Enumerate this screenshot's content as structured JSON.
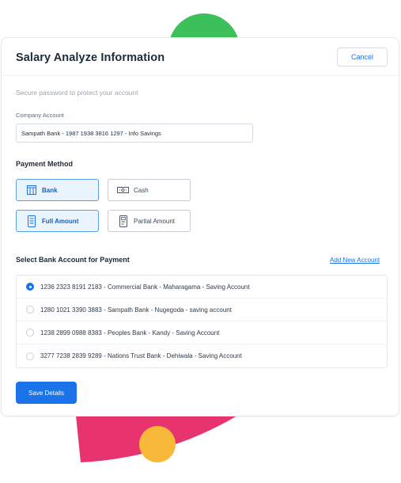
{
  "header": {
    "title": "Salary Analyze Information",
    "cancel_label": "Cancel"
  },
  "subtitle": "Secure password to protect your account",
  "company_account": {
    "label": "Company Account",
    "value": "Sampath Bank - 1987 1938 3816 1297 - Info Savings"
  },
  "payment_method": {
    "title": "Payment Method",
    "methods": [
      {
        "label": "Bank",
        "icon": "bank-icon",
        "selected": true
      },
      {
        "label": "Cash",
        "icon": "cash-icon",
        "selected": false
      }
    ],
    "amounts": [
      {
        "label": "Full Amount",
        "icon": "full-amount-icon",
        "selected": true
      },
      {
        "label": "Partial Amount",
        "icon": "partial-amount-icon",
        "selected": false
      }
    ]
  },
  "bank_accounts": {
    "title": "Select Bank Account for Payment",
    "add_label": "Add New Account",
    "items": [
      {
        "text": "1236 2323 8191 2183 - Commercial Bank - Maharagama - Saving Account",
        "selected": true
      },
      {
        "text": "1280 1021 3390 3883 - Sampath Bank - Nugegoda - saving account",
        "selected": false
      },
      {
        "text": "1238 2899 0988 8383 - Peoples Bank - Kandy - Saving Account",
        "selected": false
      },
      {
        "text": "3277 7238 2839 9289 - Nations Trust Bank - Dehiwala - Saving Account",
        "selected": false
      }
    ]
  },
  "save_label": "Save Details",
  "colors": {
    "accent": "#1a73e8",
    "selected_bg": "#eaf4fd",
    "deco_green": "#3dbf5b",
    "deco_pink": "#e8346e",
    "deco_yellow": "#f8b93a"
  }
}
